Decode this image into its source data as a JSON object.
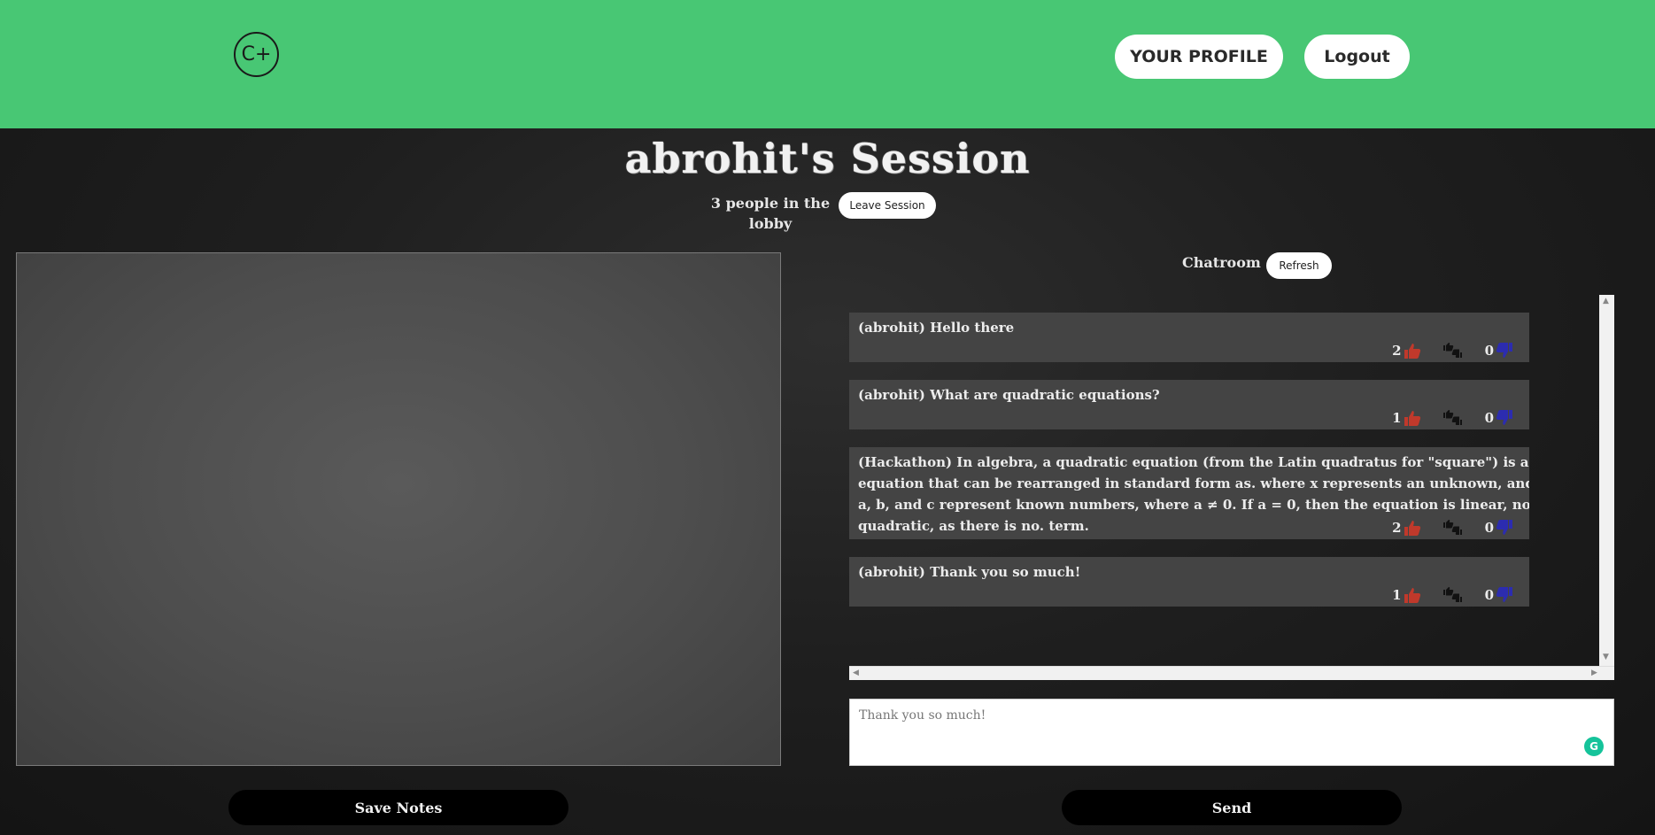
{
  "header": {
    "logo_text": "C+",
    "profile_label": "YOUR PROFILE",
    "logout_label": "Logout",
    "accent_color": "#48c774"
  },
  "session": {
    "title": "abrohit's Session",
    "lobby_count": "3 people in the lobby",
    "leave_label": "Leave Session"
  },
  "chat": {
    "title": "Chatroom",
    "refresh_label": "Refresh",
    "messages": [
      {
        "text": "(abrohit) Hello there",
        "likes": "2",
        "dislikes": "0"
      },
      {
        "text": "(abrohit) What are quadratic equations?",
        "likes": "1",
        "dislikes": "0"
      },
      {
        "text": "(Hackathon) In algebra, a quadratic equation (from the Latin quadratus for \"square\") is any equation that can be rearranged in standard form as. where x represents an unknown, and a, b, and c represent known numbers, where a ≠ 0. If a = 0, then the equation is linear, not quadratic, as there is no. term.",
        "likes": "2",
        "dislikes": "0"
      },
      {
        "text": "(abrohit) Thank you so much!",
        "likes": "1",
        "dislikes": "0"
      }
    ],
    "input_value": "Thank you so much!",
    "send_label": "Send"
  },
  "notes": {
    "save_label": "Save Notes"
  },
  "icons": {
    "like": "thumbs-up-icon",
    "neutral": "thumbs-up-down-icon",
    "dislike": "thumbs-down-icon",
    "like_color": "#c0392b",
    "dislike_color": "#2c2cb0"
  }
}
